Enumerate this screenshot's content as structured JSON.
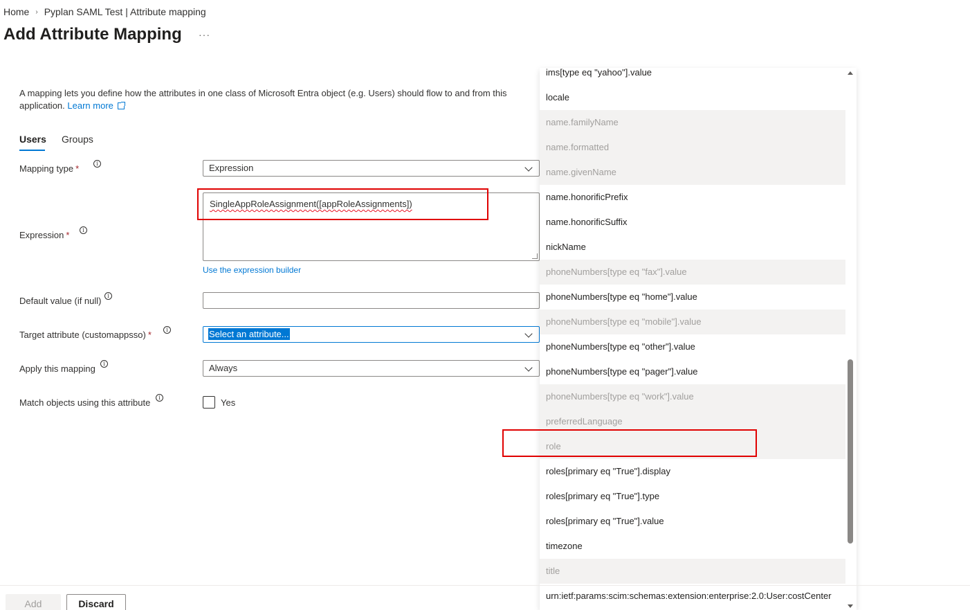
{
  "breadcrumb": {
    "home": "Home",
    "current": "Pyplan SAML Test | Attribute mapping"
  },
  "page": {
    "title": "Add Attribute Mapping",
    "more": "···"
  },
  "description": {
    "text": "A mapping lets you define how the attributes in one class of Microsoft Entra object (e.g. Users) should flow to and from this application.",
    "link": "Learn more"
  },
  "tabs": [
    "Users",
    "Groups"
  ],
  "form": {
    "mapping_type_label": "Mapping type",
    "mapping_type_value": "Expression",
    "expression_label": "Expression",
    "expression_value": "SingleAppRoleAssignment([appRoleAssignments])",
    "expression_builder_link": "Use the expression builder",
    "default_value_label": "Default value (if null)",
    "default_value": "",
    "target_attribute_label": "Target attribute (customappsso)",
    "target_attribute_value": "Select an attribute...",
    "apply_mapping_label": "Apply this mapping",
    "apply_mapping_value": "Always",
    "match_objects_label": "Match objects using this attribute",
    "match_objects_checkbox_label": "Yes",
    "required_marker": "*"
  },
  "dropdown_options": [
    {
      "label": "ims[type eq \"yahoo\"].value",
      "disabled": false
    },
    {
      "label": "locale",
      "disabled": false
    },
    {
      "label": "name.familyName",
      "disabled": true
    },
    {
      "label": "name.formatted",
      "disabled": true
    },
    {
      "label": "name.givenName",
      "disabled": true
    },
    {
      "label": "name.honorificPrefix",
      "disabled": false
    },
    {
      "label": "name.honorificSuffix",
      "disabled": false
    },
    {
      "label": "nickName",
      "disabled": false
    },
    {
      "label": "phoneNumbers[type eq \"fax\"].value",
      "disabled": true
    },
    {
      "label": "phoneNumbers[type eq \"home\"].value",
      "disabled": false
    },
    {
      "label": "phoneNumbers[type eq \"mobile\"].value",
      "disabled": true
    },
    {
      "label": "phoneNumbers[type eq \"other\"].value",
      "disabled": false
    },
    {
      "label": "phoneNumbers[type eq \"pager\"].value",
      "disabled": false
    },
    {
      "label": "phoneNumbers[type eq \"work\"].value",
      "disabled": true
    },
    {
      "label": "preferredLanguage",
      "disabled": true
    },
    {
      "label": "role",
      "disabled": true
    },
    {
      "label": "roles[primary eq \"True\"].display",
      "disabled": false
    },
    {
      "label": "roles[primary eq \"True\"].type",
      "disabled": false
    },
    {
      "label": "roles[primary eq \"True\"].value",
      "disabled": false
    },
    {
      "label": "timezone",
      "disabled": false
    },
    {
      "label": "title",
      "disabled": true
    },
    {
      "label": "urn:ietf:params:scim:schemas:extension:enterprise:2.0:User:costCenter",
      "disabled": false
    }
  ],
  "footer": {
    "add_label": "Add",
    "discard_label": "Discard"
  },
  "colors": {
    "accent": "#0078d4",
    "highlight": "#e00000",
    "disabled_bg": "#f3f2f1"
  }
}
